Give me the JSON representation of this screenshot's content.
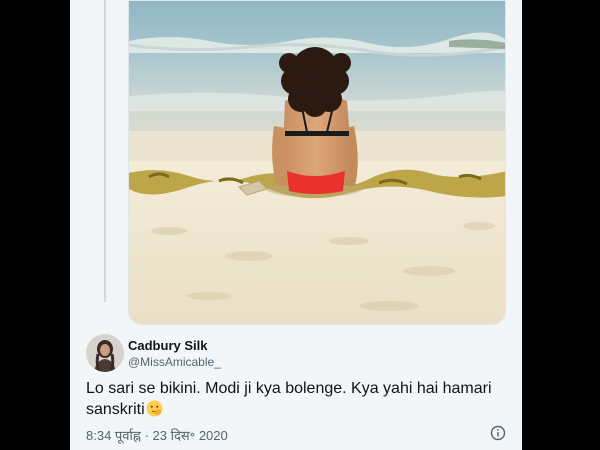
{
  "tweet": {
    "author_name": "Cadbury Silk",
    "author_handle": "@MissAmicable_",
    "text": "Lo sari se bikini. Modi ji kya bolenge. Kya yahi hai hamari sanskriti",
    "emoji": "face-with-hand-over-mouth",
    "time": "8:34 पूर्वाह्न",
    "separator": " · ",
    "date": "23 दिस॰ 2020"
  },
  "colors": {
    "background": "#000000",
    "card": "#f3f6f8",
    "text": "#0f1419",
    "muted": "#536471",
    "thread_line": "#cfd9de"
  },
  "icons": {
    "info": "info-icon",
    "emoji": "emoji-icon"
  },
  "media": {
    "type": "photo",
    "subject": "woman-in-red-bikini-sitting-on-beach"
  }
}
